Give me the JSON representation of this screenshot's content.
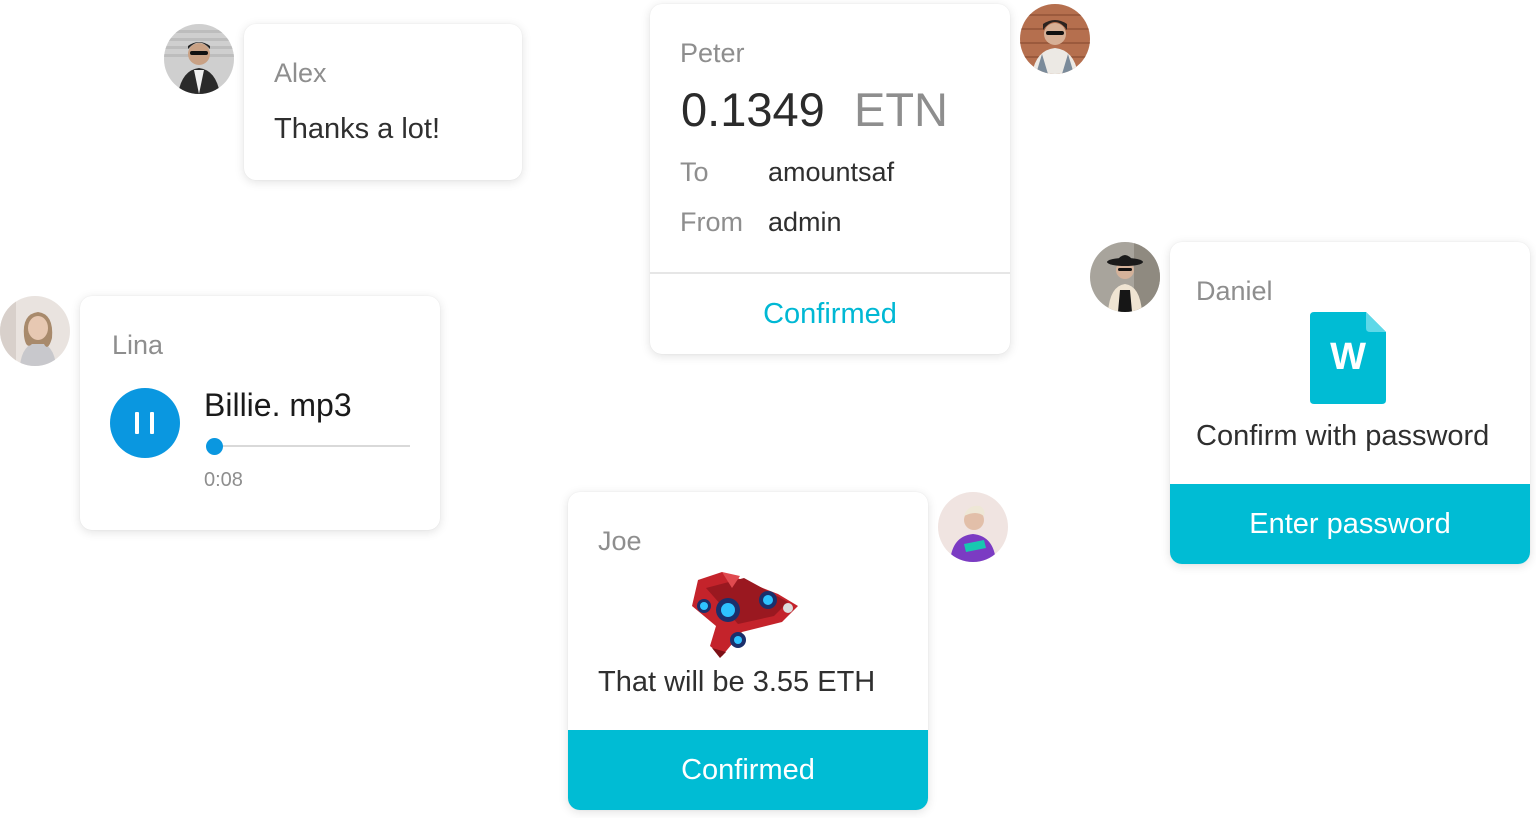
{
  "cards": {
    "alex": {
      "sender": "Alex",
      "message": "Thanks a lot!"
    },
    "peter": {
      "sender": "Peter",
      "amount": "0.1349",
      "currency": "ETN",
      "to_label": "To",
      "to_value": "amountsaf",
      "from_label": "From",
      "from_value": "admin",
      "status_label": "Confirmed"
    },
    "lina": {
      "sender": "Lina",
      "file_name": "Billie. mp3",
      "elapsed": "0:08",
      "progress_fraction": 0.0
    },
    "daniel": {
      "sender": "Daniel",
      "doc_icon_letter": "W",
      "message": "Confirm with password",
      "button_label": "Enter password"
    },
    "joe": {
      "sender": "Joe",
      "message": "That will be 3.55 ETH",
      "button_label": "Confirmed"
    }
  },
  "colors": {
    "accent": "#00bcd4",
    "player_blue": "#0a97e0",
    "sender_gray": "#8e8e8e",
    "text_dark": "#2f2f2f"
  },
  "icons": {
    "play": "pause-icon",
    "document": "word-document-icon",
    "item": "spaceship-image"
  }
}
